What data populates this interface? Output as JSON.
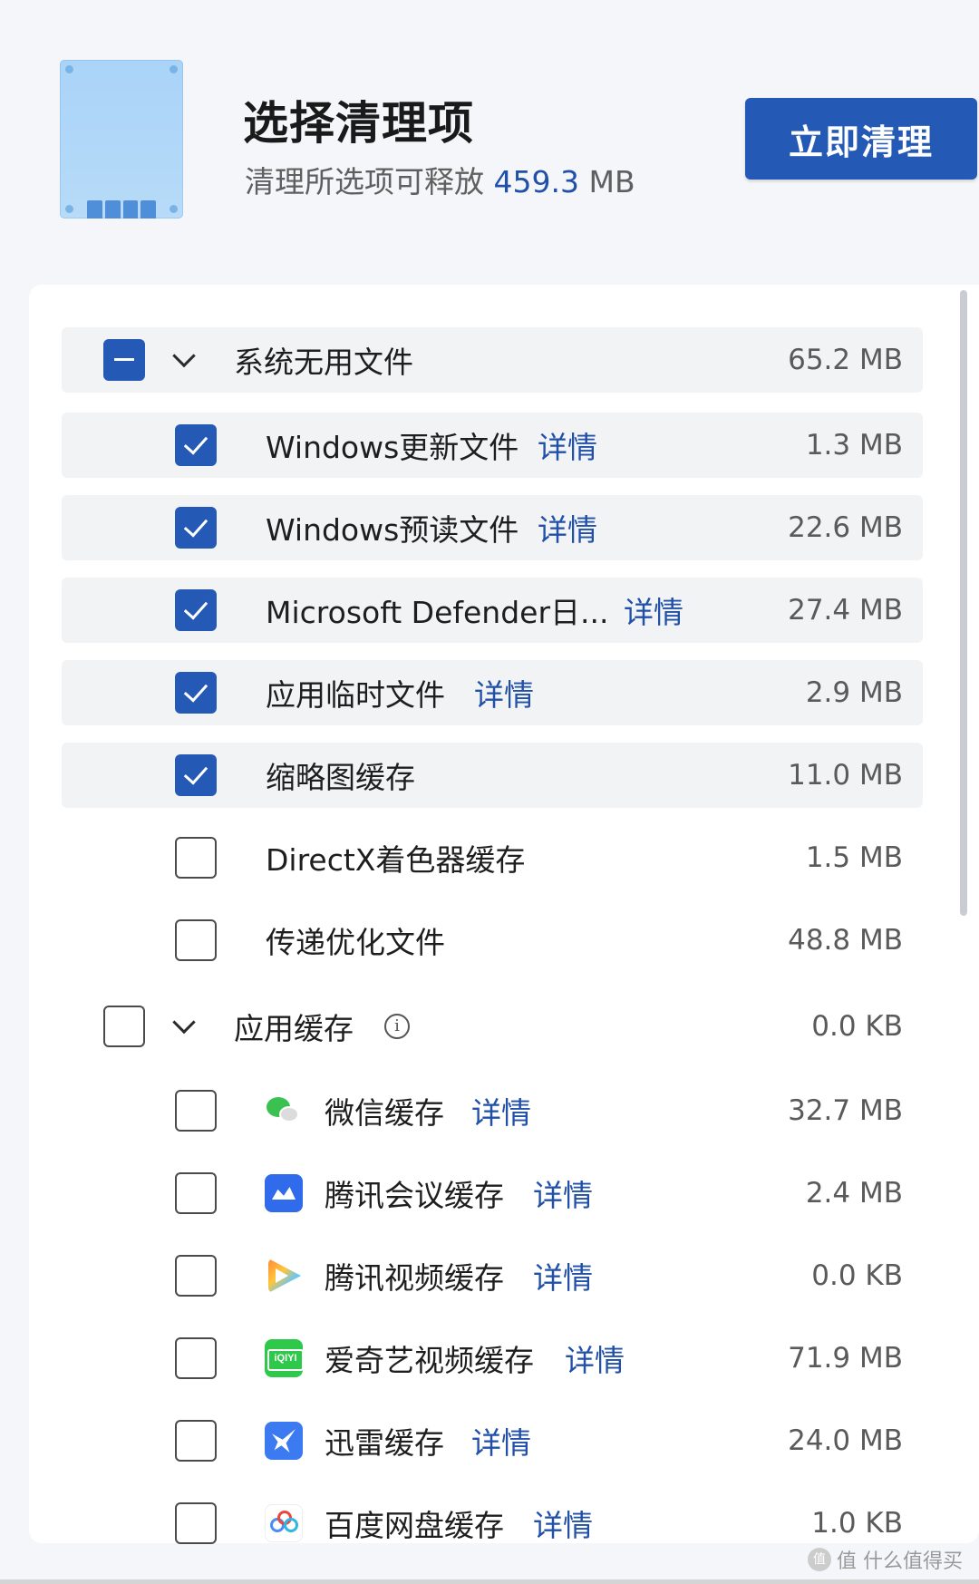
{
  "header": {
    "title": "选择清理项",
    "subtitle_prefix": "清理所选项可释放",
    "subtitle_size": "459.3",
    "subtitle_unit": "MB",
    "clean_button": "立即清理"
  },
  "groups": [
    {
      "label": "系统无用文件",
      "size": "65.2 MB",
      "state": "partial",
      "items": [
        {
          "label": "Windows更新文件",
          "detail": "详情",
          "size": "1.3 MB",
          "checked": true
        },
        {
          "label": "Windows预读文件",
          "detail": "详情",
          "size": "22.6 MB",
          "checked": true
        },
        {
          "label": "Microsoft Defender日...",
          "detail": "详情",
          "size": "27.4 MB",
          "checked": true
        },
        {
          "label": "应用临时文件",
          "detail": "详情",
          "size": "2.9 MB",
          "checked": true
        },
        {
          "label": "缩略图缓存",
          "size": "11.0 MB",
          "checked": true
        },
        {
          "label": "DirectX着色器缓存",
          "size": "1.5 MB",
          "checked": false
        },
        {
          "label": "传递优化文件",
          "size": "48.8 MB",
          "checked": false
        }
      ]
    },
    {
      "label": "应用缓存",
      "size": "0.0 KB",
      "state": "unchecked",
      "info_icon": "info-icon",
      "items": [
        {
          "label": "微信缓存",
          "detail": "详情",
          "size": "32.7 MB",
          "checked": false,
          "icon": "wechat-icon"
        },
        {
          "label": "腾讯会议缓存",
          "detail": "详情",
          "size": "2.4 MB",
          "checked": false,
          "icon": "tencent-meeting-icon"
        },
        {
          "label": "腾讯视频缓存",
          "detail": "详情",
          "size": "0.0 KB",
          "checked": false,
          "icon": "tencent-video-icon"
        },
        {
          "label": "爱奇艺视频缓存",
          "detail": "详情",
          "size": "71.9 MB",
          "checked": false,
          "icon": "iqiyi-icon"
        },
        {
          "label": "迅雷缓存",
          "detail": "详情",
          "size": "24.0 MB",
          "checked": false,
          "icon": "xunlei-icon"
        },
        {
          "label": "百度网盘缓存",
          "detail": "详情",
          "size": "1.0 KB",
          "checked": false,
          "icon": "baidu-netdisk-icon"
        }
      ]
    }
  ],
  "watermark": "值 什么值得买",
  "colors": {
    "accent": "#2559b6",
    "link": "#2150a8",
    "row_highlight": "#f2f3f5",
    "page_bg": "#f4f6f9"
  }
}
